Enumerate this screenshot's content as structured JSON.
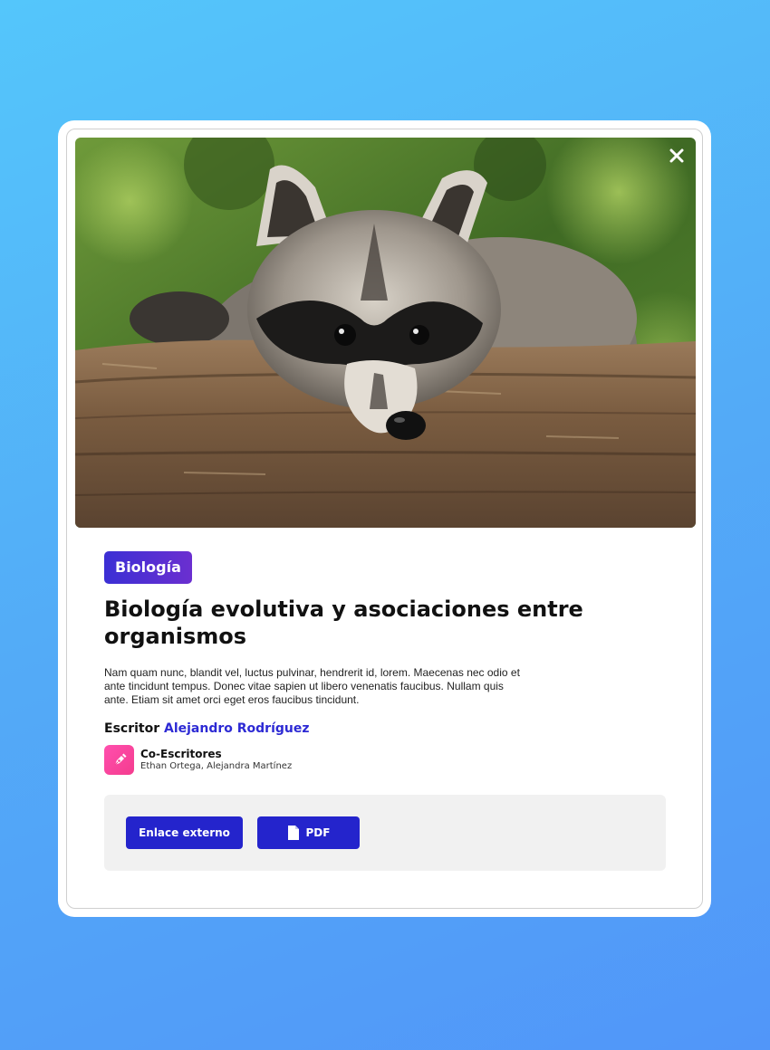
{
  "modal": {
    "image": {
      "subject": "raccoon resting on a tree log",
      "colors": {
        "foliage": "#4f7a2a",
        "bark": "#8a6a4c",
        "fur": "#b9b2a8",
        "mask": "#1c1b1a"
      }
    },
    "close_icon": "close-icon",
    "category_tag": "Biología",
    "title": "Biología evolutiva y asociaciones entre organismos",
    "description": "Nam quam nunc, blandit vel, luctus pulvinar, hendrerit id, lorem. Maecenas nec odio et ante tincidunt tempus. Donec vitae sapien ut libero venenatis faucibus. Nullam quis ante. Etiam sit amet orci eget eros faucibus tincidunt.",
    "writer": {
      "label": "Escritor",
      "name": "Alejandro Rodríguez"
    },
    "co_writers": {
      "icon": "pen-icon",
      "label": "Co-Escritores",
      "names": "Ethan Ortega, Alejandra Martínez"
    },
    "actions": {
      "external_link_label": "Enlace externo",
      "pdf_label": "PDF",
      "pdf_icon": "file-icon"
    },
    "colors": {
      "background_top": "#54c6fb",
      "background_bottom": "#5196f9",
      "accent": "#2424cc",
      "writer_name": "#2d2ad4",
      "tag_gradient_start": "#3b2fd4",
      "tag_gradient_end": "#6b2fd0",
      "co_writer_icon": "#ff4fae",
      "actions_panel": "#f1f1f1"
    }
  }
}
